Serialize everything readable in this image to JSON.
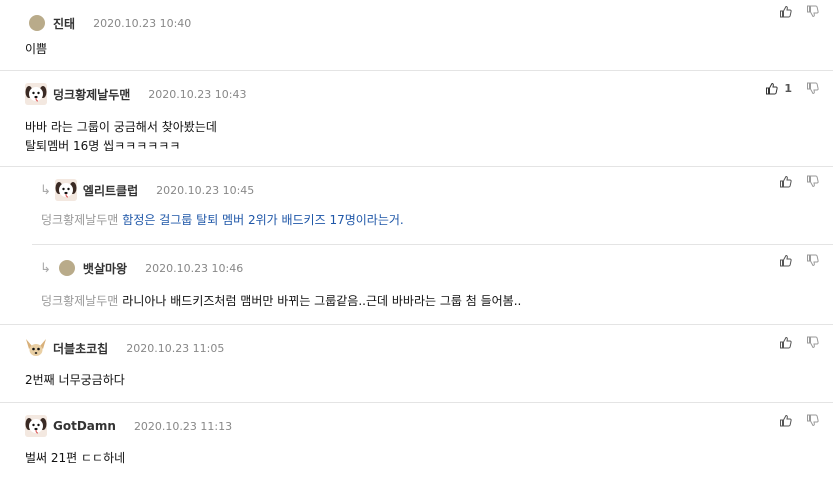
{
  "comments": [
    {
      "author": "진태",
      "date": "2020.10.23 10:40",
      "lines": [
        "이쁨"
      ],
      "up_count": "",
      "avatar": "dot-avatar"
    },
    {
      "author": "덩크황제날두맨",
      "date": "2020.10.23 10:43",
      "lines": [
        "바바 라는 그룹이 궁금해서 찾아봤는데",
        "탈퇴멤버 16명 씹ㅋㅋㅋㅋㅋㅋ"
      ],
      "up_count": "1",
      "avatar": "puppy-avatar"
    },
    {
      "author": "엘리트클럽",
      "date": "2020.10.23 10:45",
      "mention": "덩크황제날두맨",
      "text": "함정은 걸그룹 탈퇴 멤버 2위가 배드키즈 17명이라는거.",
      "avatar": "puppy-avatar"
    },
    {
      "author": "뱃살마왕",
      "date": "2020.10.23 10:46",
      "mention": "덩크황제날두맨",
      "text": "라니아나 배드키즈처럼 맴버만 바뀌는 그룹같음..근데 바바라는 그룹 첨 들어봄..",
      "avatar": "dot-avatar"
    },
    {
      "author": "더블초코칩",
      "date": "2020.10.23 11:05",
      "lines": [
        "2번째 너무궁금하다"
      ],
      "avatar": "chihuahua-avatar"
    },
    {
      "author": "GotDamn",
      "date": "2020.10.23 11:13",
      "lines": [
        "벌써 21편 ㄷㄷ하네"
      ],
      "avatar": "puppy-avatar"
    }
  ],
  "icons": {
    "up": "thumbs-up-icon",
    "down": "thumbs-down-icon",
    "reply": "reply-arrow-icon"
  },
  "colors": {
    "mention_link": "#1f57a8",
    "divider": "#e4e4e4",
    "date": "#888888"
  }
}
